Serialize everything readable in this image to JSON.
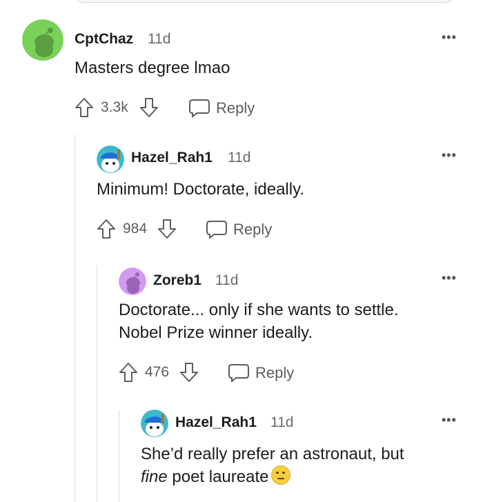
{
  "comments": [
    {
      "username": "CptChaz",
      "time": "11d",
      "body": "Masters degree lmao",
      "score": "3.3k",
      "reply_label": "Reply",
      "avatar_color": "#7ad15a",
      "avatar_icon": "snoo-green-avatar"
    },
    {
      "username": "Hazel_Rah1",
      "time": "11d",
      "body": "Minimum! Doctorate, ideally.",
      "score": "984",
      "reply_label": "Reply",
      "avatar_color": "#3fb9c9",
      "avatar_icon": "snoo-blue-cap-avatar"
    },
    {
      "username": "Zoreb1",
      "time": "11d",
      "body_line1": "Doctorate... only if she wants to settle.",
      "body_line2": "Nobel Prize winner ideally.",
      "score": "476",
      "reply_label": "Reply",
      "avatar_color": "#d39af0",
      "avatar_icon": "snoo-purple-avatar"
    },
    {
      "username": "Hazel_Rah1",
      "time": "11d",
      "body_line1": "She’d really prefer an astronaut, but",
      "body_italic": "fine",
      "body_line2_rest": " poet laureate",
      "emoji": "eye-roll-emoji",
      "avatar_color": "#3fb9c9",
      "avatar_icon": "snoo-blue-cap-avatar"
    }
  ],
  "more_label": "•••",
  "colors": {
    "text": "#1c1c1c",
    "meta": "#6a6a6a",
    "thread": "#dcdcdc"
  }
}
